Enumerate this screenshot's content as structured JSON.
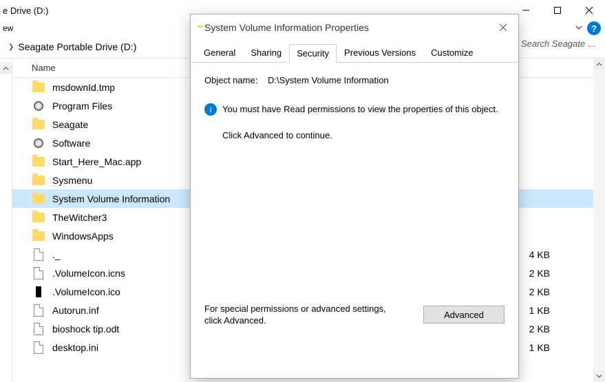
{
  "explorer": {
    "window_title_fragment": "e Drive (D:)",
    "tabrow_fragment": "ew",
    "breadcrumb": "Seagate Portable Drive (D:)",
    "search_placeholder": "Search Seagate Po...",
    "columns": {
      "name": "Name"
    },
    "items": [
      {
        "name": "msdownId.tmp",
        "icon": "folder"
      },
      {
        "name": "Program Files",
        "icon": "cd"
      },
      {
        "name": "Seagate",
        "icon": "folder"
      },
      {
        "name": "Software",
        "icon": "cd"
      },
      {
        "name": "Start_Here_Mac.app",
        "icon": "folder"
      },
      {
        "name": "Sysmenu",
        "icon": "folder"
      },
      {
        "name": "System Volume Information",
        "icon": "folder",
        "selected": true
      },
      {
        "name": "TheWitcher3",
        "icon": "folder"
      },
      {
        "name": "WindowsApps",
        "icon": "folder"
      },
      {
        "name": "._",
        "icon": "file"
      },
      {
        "name": ".VolumeIcon.icns",
        "icon": "file"
      },
      {
        "name": ".VolumeIcon.ico",
        "icon": "black"
      },
      {
        "name": "Autorun.inf",
        "icon": "file"
      },
      {
        "name": "bioshock tip.odt",
        "icon": "file"
      },
      {
        "name": "desktop.ini",
        "icon": "file"
      }
    ],
    "sizes": [
      "4 KB",
      "2 KB",
      "2 KB",
      "1 KB",
      "2 KB",
      "1 KB"
    ]
  },
  "dialog": {
    "title": "System Volume Information Properties",
    "tabs": [
      "General",
      "Sharing",
      "Security",
      "Previous Versions",
      "Customize"
    ],
    "active_tab": "Security",
    "object_label": "Object name:",
    "object_value": "D:\\System Volume Information",
    "info_text": "You must have Read permissions to view the properties of this object.",
    "hint_text": "Click Advanced to continue.",
    "footer_text": "For special permissions or advanced settings, click Advanced.",
    "advanced_label": "Advanced"
  }
}
